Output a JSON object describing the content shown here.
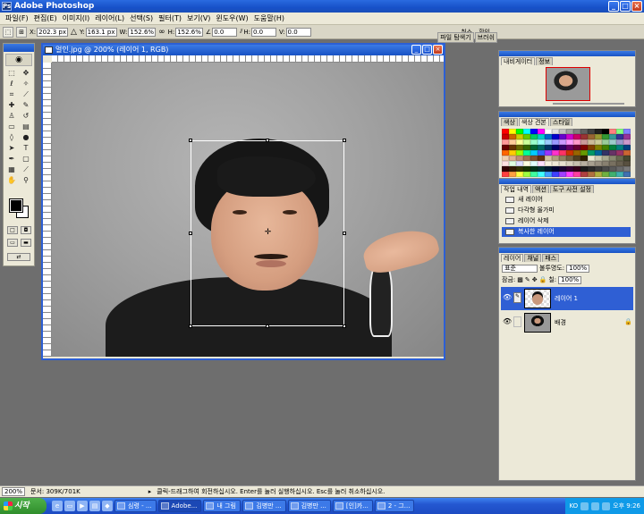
{
  "app": {
    "title": "Adobe Photoshop",
    "icon": "Ps"
  },
  "window_buttons": {
    "minimize": "_",
    "maximize": "□",
    "close": "×"
  },
  "menu": [
    "파일(F)",
    "편집(E)",
    "이미지(I)",
    "레이어(L)",
    "선택(S)",
    "필터(T)",
    "보기(V)",
    "윈도우(W)",
    "도움말(H)"
  ],
  "options": {
    "x_label": "X:",
    "x_value": "202.3 px",
    "y_label": "Y:",
    "y_value": "163.1 px",
    "w_label": "W:",
    "w_value": "152.6%",
    "h_label": "H:",
    "h_value": "152.6%",
    "angle_value": "0.0",
    "hskew_label": "H:",
    "hskew_value": "0.0",
    "vskew_label": "V:",
    "vskew_value": "0.0",
    "cancel_label": "취소",
    "commit_label": "확인"
  },
  "palette_well": {
    "tabs": [
      "파일 탐색기",
      "브러쉬"
    ]
  },
  "document": {
    "title": "얼인.jpg @ 200% (레이어 1, RGB)"
  },
  "navigator": {
    "tabs": [
      "내비게이터",
      "정보"
    ]
  },
  "swatches": {
    "tabs": [
      "색상",
      "색상 견본",
      "스타일"
    ],
    "colors": [
      "#ff0000",
      "#ffff00",
      "#00ff00",
      "#00ffff",
      "#0000ff",
      "#ff00ff",
      "#ffffff",
      "#e0e0e0",
      "#c0c0c0",
      "#a0a0a0",
      "#808080",
      "#606060",
      "#404040",
      "#202020",
      "#000000",
      "#ff8080",
      "#80ff80",
      "#8080ff",
      "#cc0000",
      "#cc6600",
      "#cccc00",
      "#66cc00",
      "#00cc66",
      "#00cccc",
      "#0066cc",
      "#0000cc",
      "#6600cc",
      "#cc00cc",
      "#cc0066",
      "#993333",
      "#996633",
      "#999933",
      "#339933",
      "#339999",
      "#333399",
      "#993399",
      "#ff9999",
      "#ffcc99",
      "#ffff99",
      "#ccff99",
      "#99ffcc",
      "#99ffff",
      "#99ccff",
      "#9999ff",
      "#cc99ff",
      "#ff99ff",
      "#ff99cc",
      "#cc9999",
      "#ccbb99",
      "#cccc99",
      "#99cc99",
      "#99cccc",
      "#9999cc",
      "#cc99cc",
      "#660000",
      "#663300",
      "#666600",
      "#336600",
      "#006633",
      "#006666",
      "#003366",
      "#000066",
      "#330066",
      "#660066",
      "#660033",
      "#800000",
      "#804000",
      "#808000",
      "#408000",
      "#008040",
      "#008080",
      "#004080",
      "#ff6600",
      "#ffcc00",
      "#99ff00",
      "#00ff99",
      "#00ccff",
      "#3366ff",
      "#9933ff",
      "#ff33cc",
      "#ff3366",
      "#cc3300",
      "#996600",
      "#669900",
      "#009966",
      "#006699",
      "#333366",
      "#663366",
      "#993366",
      "#cc6633",
      "#f0d0b0",
      "#e0b090",
      "#c09070",
      "#a07050",
      "#805030",
      "#603010",
      "#d0c0a0",
      "#b0a080",
      "#908060",
      "#706040",
      "#504020",
      "#302000",
      "#e8e8d0",
      "#c8c8b0",
      "#a8a890",
      "#888870",
      "#686850",
      "#484830",
      "#ffe0e0",
      "#e0ffe0",
      "#e0e0ff",
      "#ffffe0",
      "#e0ffff",
      "#ffe0ff",
      "#f8f0e0",
      "#f0e8d8",
      "#e8e0d0",
      "#d8d0c0",
      "#c8c0b0",
      "#b8b0a0",
      "#a8a090",
      "#989080",
      "#888070",
      "#787060",
      "#686050",
      "#585040",
      "#330000",
      "#331900",
      "#333300",
      "#193300",
      "#003319",
      "#003333",
      "#001933",
      "#000033",
      "#190033",
      "#330033",
      "#330019",
      "#1a1a1a",
      "#2a2a2a",
      "#3a3a3a",
      "#4a4a4a",
      "#5a5a5a",
      "#6a6a6a",
      "#7a7a7a",
      "#ff4040",
      "#ffa040",
      "#ffff40",
      "#a0ff40",
      "#40ffa0",
      "#40ffff",
      "#40a0ff",
      "#4040ff",
      "#a040ff",
      "#ff40ff",
      "#ff40a0",
      "#b04040",
      "#b07040",
      "#b0b040",
      "#70b040",
      "#40b070",
      "#40b0b0",
      "#4070b0"
    ]
  },
  "history": {
    "tabs": [
      "작업 내역",
      "액션",
      "도구 사전 설정"
    ],
    "items": [
      "새 레이어",
      "다각형 올가미",
      "레이어 삭제",
      "복사한 레이어"
    ]
  },
  "layers": {
    "tabs": [
      "레이어",
      "채널",
      "패스"
    ],
    "blend_mode": "표준",
    "opacity_label": "불투명도:",
    "opacity_value": "100%",
    "lock_label": "잠금:",
    "fill_label": "칠:",
    "fill_value": "100%",
    "rows": [
      {
        "name": "레이어 1",
        "active": true
      },
      {
        "name": "배경",
        "active": false
      }
    ]
  },
  "status": {
    "zoom": "200%",
    "doc_info": "문서: 309K/701K",
    "hint": "클릭-드래그하여 회전하십시오. Enter를 눌러 실행하십시오. Esc를 눌러 취소하십시오."
  },
  "taskbar": {
    "start_label": "시작",
    "tasks": [
      {
        "label": "심령 - ...",
        "active": false
      },
      {
        "label": "Adobe...",
        "active": true
      },
      {
        "label": "내 그림",
        "active": false
      },
      {
        "label": "김병만 ...",
        "active": false
      },
      {
        "label": "김병만 ...",
        "active": false
      },
      {
        "label": "[인]카...",
        "active": false
      },
      {
        "label": "2 - 그...",
        "active": false
      }
    ],
    "clock": "오후 9:26",
    "ime": "KO"
  }
}
